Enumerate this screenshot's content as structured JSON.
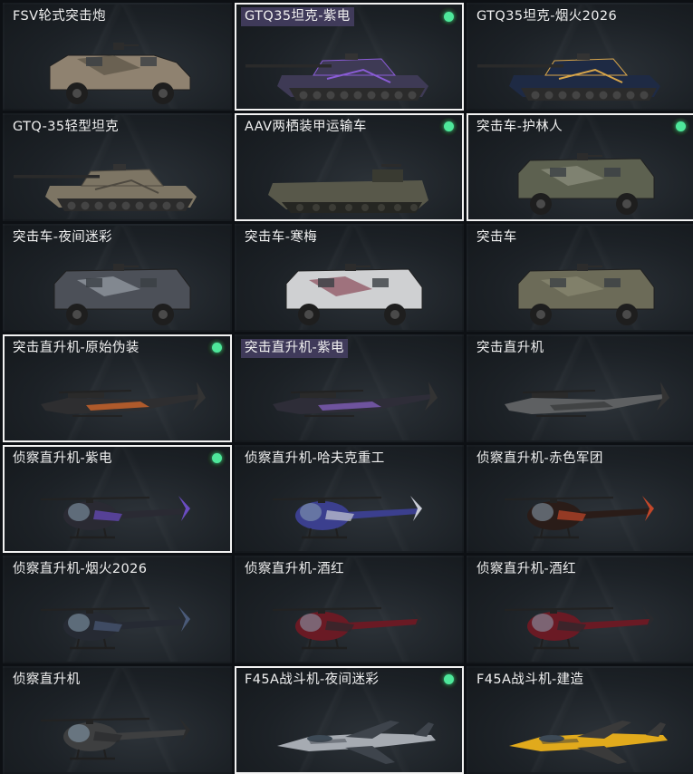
{
  "items": [
    {
      "name": "FSV轮式突击炮",
      "type": "armored-car",
      "selected": false,
      "equipped": false,
      "highlight": false,
      "colors": [
        "#8f8270",
        "#5a5246"
      ]
    },
    {
      "name": "GTQ35坦克-紫电",
      "type": "tank",
      "selected": true,
      "equipped": true,
      "highlight": true,
      "colors": [
        "#3e3a55",
        "#8a5cd6"
      ]
    },
    {
      "name": "GTQ35坦克-烟火2026",
      "type": "tank",
      "selected": false,
      "equipped": false,
      "highlight": false,
      "colors": [
        "#1e2a44",
        "#d9a64a"
      ]
    },
    {
      "name": "GTQ-35轻型坦克",
      "type": "tank",
      "selected": false,
      "equipped": false,
      "highlight": false,
      "colors": [
        "#7d7564",
        "#4e4940"
      ]
    },
    {
      "name": "AAV两栖装甲运输车",
      "type": "amphibious",
      "selected": true,
      "equipped": true,
      "highlight": false,
      "colors": [
        "#58584a",
        "#393a31"
      ]
    },
    {
      "name": "突击车-护林人",
      "type": "assault-vehicle",
      "selected": true,
      "equipped": true,
      "highlight": false,
      "colors": [
        "#5d6150",
        "#8e907f"
      ]
    },
    {
      "name": "突击车-夜间迷彩",
      "type": "assault-vehicle",
      "selected": false,
      "equipped": false,
      "highlight": false,
      "colors": [
        "#4c5058",
        "#9aa0a8"
      ]
    },
    {
      "name": "突击车-寒梅",
      "type": "assault-vehicle",
      "selected": false,
      "equipped": false,
      "highlight": false,
      "colors": [
        "#cfd0d2",
        "#8a4a58"
      ]
    },
    {
      "name": "突击车",
      "type": "assault-vehicle",
      "selected": false,
      "equipped": false,
      "highlight": false,
      "colors": [
        "#6c6b58",
        "#8a8972"
      ]
    },
    {
      "name": "突击直升机-原始伪装",
      "type": "attack-helicopter",
      "selected": true,
      "equipped": true,
      "highlight": false,
      "colors": [
        "#2e2e30",
        "#c6612a"
      ]
    },
    {
      "name": "突击直升机-紫电",
      "type": "attack-helicopter",
      "selected": false,
      "equipped": false,
      "highlight": true,
      "colors": [
        "#2e2d38",
        "#7a5ab0"
      ]
    },
    {
      "name": "突击直升机",
      "type": "attack-helicopter",
      "selected": false,
      "equipped": false,
      "highlight": false,
      "colors": [
        "#5e6062",
        "#3c3e40"
      ]
    },
    {
      "name": "侦察直升机-紫电",
      "type": "scout-helicopter",
      "selected": true,
      "equipped": true,
      "highlight": false,
      "colors": [
        "#2a2a33",
        "#6a4cc0"
      ]
    },
    {
      "name": "侦察直升机-哈夫克重工",
      "type": "scout-helicopter",
      "selected": false,
      "equipped": false,
      "highlight": false,
      "colors": [
        "#3b3f8e",
        "#c9ccd6"
      ]
    },
    {
      "name": "侦察直升机-赤色军团",
      "type": "scout-helicopter",
      "selected": false,
      "equipped": false,
      "highlight": false,
      "colors": [
        "#2a1c18",
        "#c2472a"
      ]
    },
    {
      "name": "侦察直升机-烟火2026",
      "type": "scout-helicopter",
      "selected": false,
      "equipped": false,
      "highlight": false,
      "colors": [
        "#262a33",
        "#4a5a78"
      ]
    },
    {
      "name": "侦察直升机-酒红",
      "type": "scout-helicopter",
      "selected": false,
      "equipped": false,
      "highlight": false,
      "colors": [
        "#6a1a24",
        "#2a2a2e"
      ]
    },
    {
      "name": "侦察直升机-酒红",
      "type": "scout-helicopter",
      "selected": false,
      "equipped": false,
      "highlight": false,
      "colors": [
        "#6a1a24",
        "#2a2a2e"
      ]
    },
    {
      "name": "侦察直升机",
      "type": "scout-helicopter",
      "selected": false,
      "equipped": false,
      "highlight": false,
      "colors": [
        "#3e3f40",
        "#2a2b2c"
      ]
    },
    {
      "name": "F45A战斗机-夜间迷彩",
      "type": "fighter-jet",
      "selected": true,
      "equipped": true,
      "highlight": false,
      "colors": [
        "#a6abb2",
        "#3e444c"
      ]
    },
    {
      "name": "F45A战斗机-建造",
      "type": "fighter-jet",
      "selected": false,
      "equipped": false,
      "highlight": false,
      "colors": [
        "#e1aa1c",
        "#3a3a3a"
      ]
    }
  ]
}
